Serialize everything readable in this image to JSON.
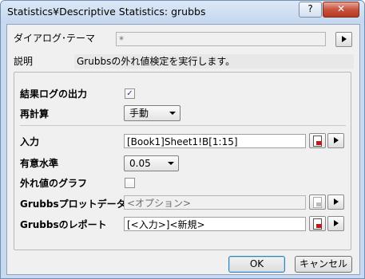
{
  "window": {
    "title": "Statistics¥Descriptive Statistics: grubbs",
    "help_label": "?",
    "close_label": "✕"
  },
  "theme": {
    "label": "ダイアログ･テーマ",
    "value": "*",
    "arrow_icon": "right-triangle-icon"
  },
  "description": {
    "label": "説明",
    "value": "Grubbsの外れ値検定を実行します。"
  },
  "options": {
    "result_log": {
      "label": "結果ログの出力",
      "checked": true
    },
    "recalc": {
      "label": "再計算",
      "value": "手動"
    }
  },
  "inputs": {
    "input": {
      "label": "入力",
      "value": "[Book1]Sheet1!B[1:15]"
    },
    "significance": {
      "label": "有意水準",
      "value": "0.05"
    },
    "outlier_graph": {
      "label": "外れ値のグラフ",
      "checked": false
    },
    "grubbs_plot": {
      "label": "Grubbsプロットデータ",
      "placeholder": "<オプション>"
    },
    "grubbs_report": {
      "label": "Grubbsのレポート",
      "value": "[<入力>]<新規>"
    }
  },
  "buttons": {
    "ok": "OK",
    "cancel": "キャンセル"
  },
  "colors": {
    "title_bar": "#c9daf0",
    "close_button": "#c7523d",
    "client_bg": "#f0f0f0"
  }
}
